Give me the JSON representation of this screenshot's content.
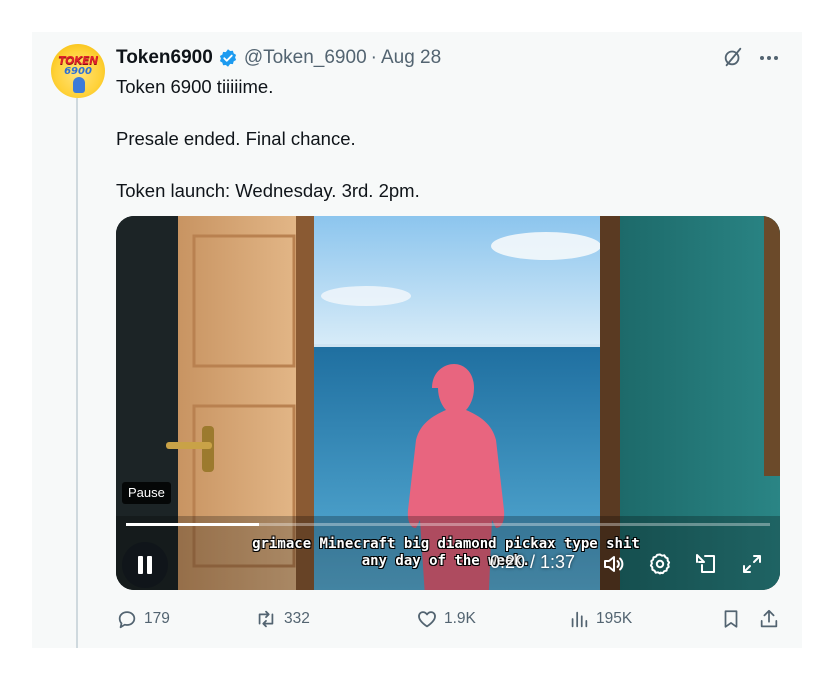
{
  "author": {
    "name": "Token6900",
    "handle": "@Token_6900",
    "separator": "·",
    "date": "Aug 28",
    "avatar_text_line1": "TOKEN",
    "avatar_text_line2": "6900"
  },
  "tweet": {
    "line1": "Token 6900 tiiiiime.",
    "line2": "Presale ended. Final chance.",
    "line3": "Token launch: Wednesday. 3rd. 2pm."
  },
  "video": {
    "tooltip": "Pause",
    "caption_line1": "grimace Minecraft big diamond pickax type shit",
    "caption_line2": "any day of the week.",
    "time": "0:20 / 1:37",
    "progress": 0.206
  },
  "actions": {
    "replies": "179",
    "reposts": "332",
    "likes": "1.9K",
    "views": "195K"
  },
  "colors": {
    "verified": "#1d9bf0",
    "secondary_text": "#536471",
    "thread_line": "#cfd9de",
    "card_bg": "#f7f9f9"
  },
  "icons": [
    "verified-badge-icon",
    "grok-icon",
    "more-icon",
    "pause-icon",
    "volume-icon",
    "settings-icon",
    "pip-icon",
    "fullscreen-icon",
    "reply-icon",
    "repost-icon",
    "like-icon",
    "views-icon",
    "bookmark-icon",
    "share-icon"
  ]
}
